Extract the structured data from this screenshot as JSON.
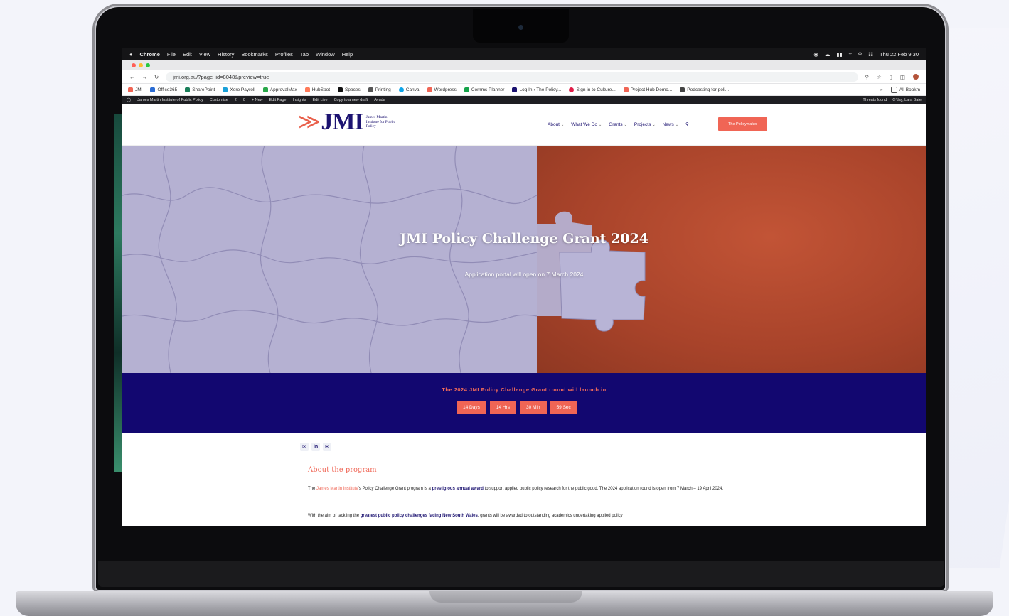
{
  "menubar": {
    "apple": "",
    "items": [
      "Chrome",
      "File",
      "Edit",
      "View",
      "History",
      "Bookmarks",
      "Profiles",
      "Tab",
      "Window",
      "Help"
    ],
    "datetime": "Thu 22 Feb 9:30"
  },
  "browser": {
    "url": "jmi.org.au/?page_id=8048&preview=true",
    "bookmarks": [
      "JMI",
      "Office365",
      "SharePoint",
      "Xero Payroll",
      "ApprovalMax",
      "HubSpot",
      "Spaces",
      "Printing",
      "Canva",
      "Wordpress",
      "Comms Planner",
      "Log In ‹ The Policy...",
      "Sign in to Culture...",
      "Project Hub Demo...",
      "Podcasting for poli..."
    ],
    "more": "»",
    "all_bookmarks": "All Bookm",
    "bookmark_colors": [
      "#f06555",
      "#2b6cd4",
      "#1a7f5a",
      "#1aa0d8",
      "#2aa84a",
      "#ff7a59",
      "#111111",
      "#555555",
      "#0ea5e9",
      "#f06555",
      "#16a34a",
      "#1b1270",
      "#e11d48",
      "#f06555",
      "#444444"
    ]
  },
  "wpbar": {
    "left": [
      "James Martin Institute of Public Policy",
      "Customise",
      "2",
      "0",
      "+ New",
      "Edit Page",
      "Insights",
      "Edit Live",
      "Copy to a new draft",
      "Avada"
    ],
    "right": [
      "Threats found",
      "G'day, Lara Bate"
    ]
  },
  "site": {
    "logo_text": "JMI",
    "logo_sub": "James Martin Institute for Public Policy",
    "nav": [
      "About",
      "What We Do",
      "Grants",
      "Projects",
      "News"
    ],
    "cta": "The Policymaker",
    "accent": "#f06555",
    "navy": "#120770"
  },
  "hero": {
    "title": "JMI Policy Challenge Grant 2024",
    "subtitle": "Application portal will open on 7 March 2024"
  },
  "countdown": {
    "label": "The 2024 JMI Policy Challenge Grant round will launch in",
    "boxes": [
      "14 Days",
      "14 Hrs",
      "30 Min",
      "59 Sec"
    ]
  },
  "content": {
    "share_icons": [
      "twitter-icon",
      "linkedin-icon",
      "email-icon"
    ],
    "about_heading": "About the program",
    "p1_a": "The ",
    "p1_link": "James Martin Institute",
    "p1_b": "'s Policy Challenge Grant program is a ",
    "p1_bold": "prestigious annual award",
    "p1_c": " to support applied public policy research for the public good. The 2024 application round is open from 7 March – 19 April 2024.",
    "p2_a": "With the aim of tackling the ",
    "p2_bold": "greatest public policy challenges facing New South Wales",
    "p2_b": ", grants will be awarded to outstanding academics undertaking applied policy"
  }
}
